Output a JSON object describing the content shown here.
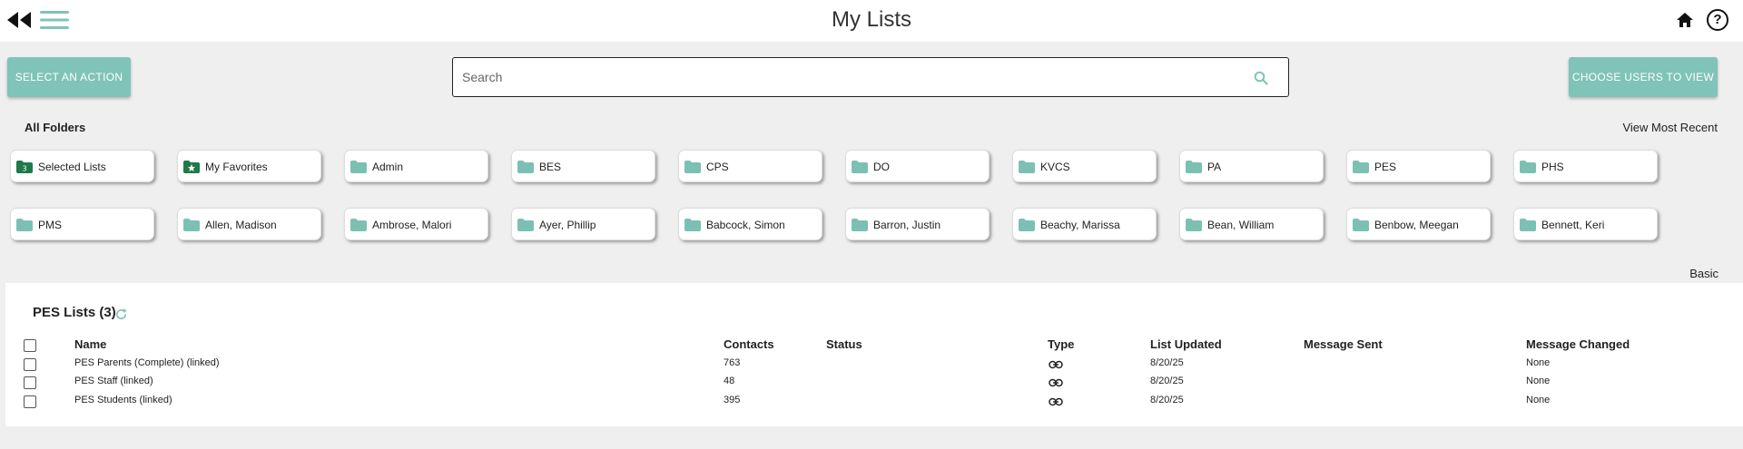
{
  "header": {
    "title": "My Lists",
    "help_glyph": "?"
  },
  "toolbar": {
    "action_label": "SELECT AN ACTION",
    "users_label": "CHOOSE USERS TO VIEW",
    "search_placeholder": "Search"
  },
  "folders": {
    "heading": "All Folders",
    "view_recent": "View Most Recent",
    "items": [
      {
        "label": "Selected Lists",
        "icon": "selected-folder-icon"
      },
      {
        "label": "My Favorites",
        "icon": "favorites-folder-icon"
      },
      {
        "label": "Admin",
        "icon": "folder-icon"
      },
      {
        "label": "BES",
        "icon": "folder-icon"
      },
      {
        "label": "CPS",
        "icon": "folder-icon"
      },
      {
        "label": "DO",
        "icon": "folder-icon"
      },
      {
        "label": "KVCS",
        "icon": "folder-icon"
      },
      {
        "label": "PA",
        "icon": "folder-icon"
      },
      {
        "label": "PES",
        "icon": "folder-icon"
      },
      {
        "label": "PHS",
        "icon": "folder-icon"
      },
      {
        "label": "PMS",
        "icon": "folder-icon"
      },
      {
        "label": "Allen, Madison",
        "icon": "folder-icon"
      },
      {
        "label": "Ambrose, Malori",
        "icon": "folder-icon"
      },
      {
        "label": "Ayer, Phillip",
        "icon": "folder-icon"
      },
      {
        "label": "Babcock, Simon",
        "icon": "folder-icon"
      },
      {
        "label": "Barron, Justin",
        "icon": "folder-icon"
      },
      {
        "label": "Beachy, Marissa",
        "icon": "folder-icon"
      },
      {
        "label": "Bean, William",
        "icon": "folder-icon"
      },
      {
        "label": "Benbow, Meegan",
        "icon": "folder-icon"
      },
      {
        "label": "Bennett, Keri",
        "icon": "folder-icon"
      }
    ]
  },
  "view_mode": "Basic",
  "lists": {
    "title": "PES Lists (3)",
    "columns": {
      "name": "Name",
      "contacts": "Contacts",
      "status": "Status",
      "type": "Type",
      "updated": "List Updated",
      "sent": "Message Sent",
      "changed": "Message Changed"
    },
    "rows": [
      {
        "name": "PES Parents (Complete) (linked)",
        "contacts": "763",
        "status": "",
        "type": "link-icon",
        "updated": "8/20/25",
        "sent": "",
        "changed": "None"
      },
      {
        "name": "PES Staff (linked)",
        "contacts": "48",
        "status": "",
        "type": "link-icon",
        "updated": "8/20/25",
        "sent": "",
        "changed": "None"
      },
      {
        "name": "PES Students (linked)",
        "contacts": "395",
        "status": "",
        "type": "link-icon",
        "updated": "8/20/25",
        "sent": "",
        "changed": "None"
      }
    ]
  },
  "colors": {
    "accent": "#80c3b8",
    "folder_icon": "#7cc0b3",
    "selected_folder": "#1f7a4a"
  }
}
